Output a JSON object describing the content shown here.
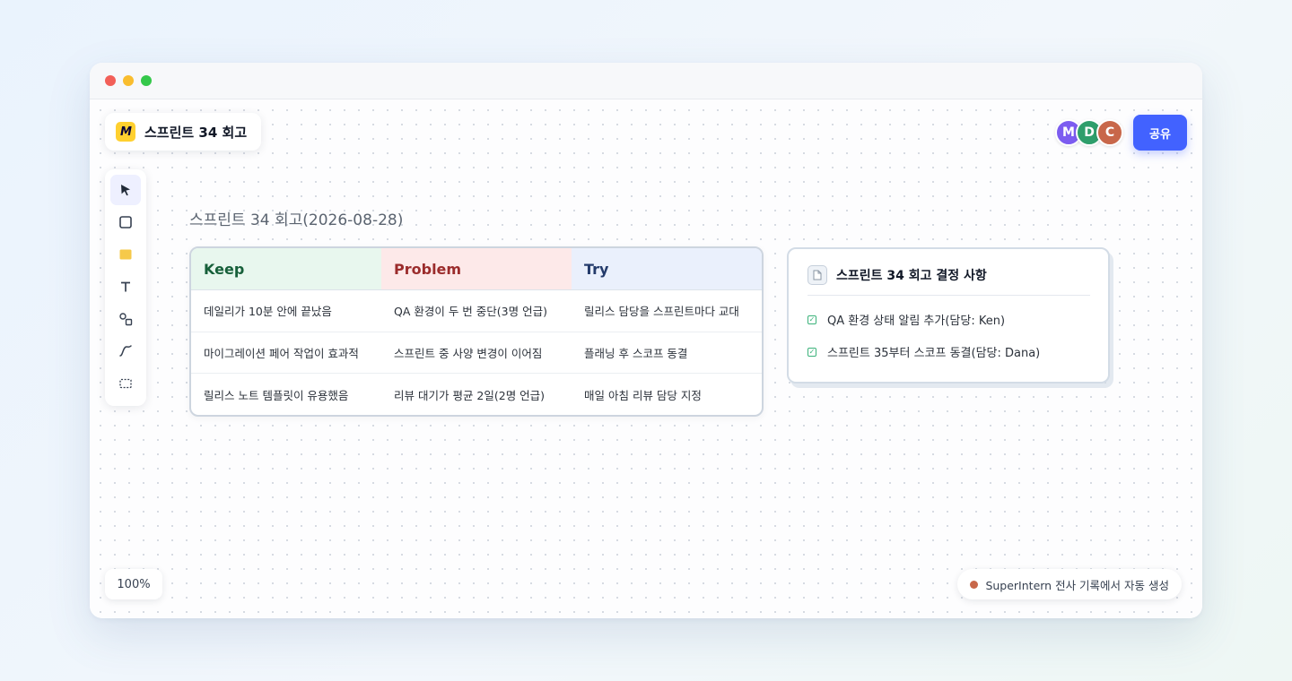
{
  "board": {
    "title": "스프린트 34 회고",
    "logo_text": "M"
  },
  "collaborators": [
    {
      "initial": "M",
      "color": "#7c5cf0"
    },
    {
      "initial": "D",
      "color": "#2e9e6b"
    },
    {
      "initial": "C",
      "color": "#c8674a"
    }
  ],
  "share_button": {
    "label": "공유",
    "color": "#4262ff"
  },
  "toolbar": {
    "tools": [
      {
        "name": "select",
        "icon": "cursor-icon",
        "active": true
      },
      {
        "name": "shape",
        "icon": "square-icon",
        "active": false
      },
      {
        "name": "sticky-note",
        "icon": "sticky-note-icon",
        "active": false
      },
      {
        "name": "text",
        "icon": "text-icon",
        "active": false
      },
      {
        "name": "connector",
        "icon": "connector-icon",
        "active": false
      },
      {
        "name": "pen",
        "icon": "pen-icon",
        "active": false
      },
      {
        "name": "frame",
        "icon": "frame-icon",
        "active": false
      }
    ]
  },
  "frame": {
    "title": "스프린트 34 회고(2026-08-28)"
  },
  "kpt": {
    "headers": [
      "Keep",
      "Problem",
      "Try"
    ],
    "rows": [
      [
        "데일리가 10분 안에 끝났음",
        "QA 환경이 두 번 중단(3명 언급)",
        "릴리스 담당을 스프린트마다 교대"
      ],
      [
        "마이그레이션 페어 작업이 효과적",
        "스프린트 중 사양 변경이 이어짐",
        "플래닝 후 스코프 동결"
      ],
      [
        "릴리스 노트 템플릿이 유용했음",
        "리뷰 대기가 평균 2일(2명 언급)",
        "매일 아침 리뷰 담당 지정"
      ]
    ]
  },
  "decisions": {
    "title": "스프린트 34 회고 결정 사항",
    "items": [
      "QA 환경 상태 알림 추가(담당: Ken)",
      "스프린트 35부터 스코프 동결(담당: Dana)"
    ]
  },
  "zoom": {
    "level": "100%"
  },
  "source": {
    "text": "SuperIntern 전사 기록에서 자동 생성",
    "dot_color": "#c8674a"
  }
}
